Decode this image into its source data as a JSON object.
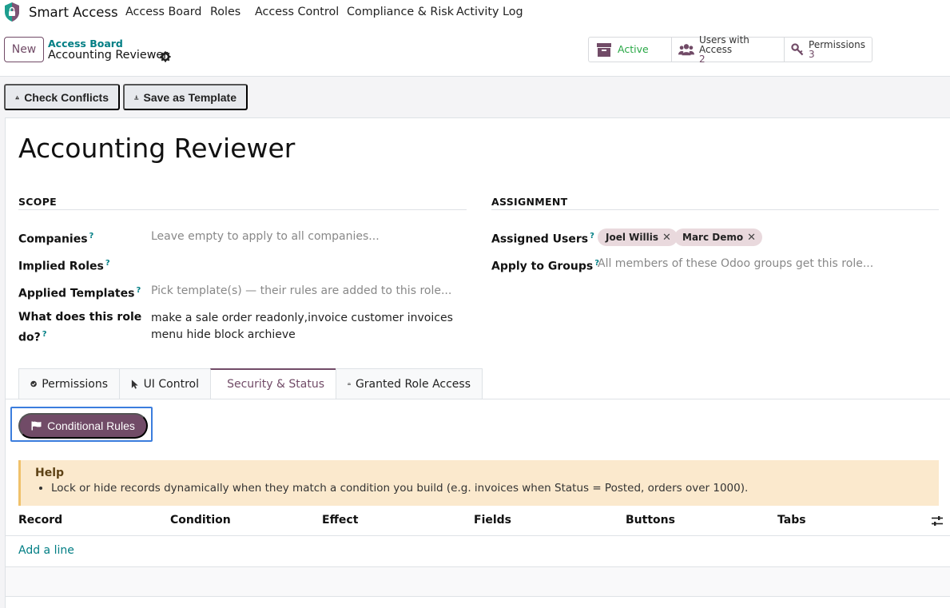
{
  "app": {
    "name": "Smart Access",
    "nav": [
      "Access Board",
      "Roles",
      "Access Control",
      "Compliance & Risk",
      "Activity Log"
    ]
  },
  "control_panel": {
    "new_label": "New",
    "breadcrumb_parent": "Access Board",
    "breadcrumb_current": "Accounting Reviewer",
    "smart_buttons": {
      "active": {
        "label": "Active"
      },
      "users": {
        "label": "Users with Access",
        "count": "2"
      },
      "permissions": {
        "label": "Permissions",
        "count": "3"
      }
    }
  },
  "status_bar": {
    "check_conflicts": "Check Conflicts",
    "save_template": "Save as Template"
  },
  "form": {
    "title": "Accounting Reviewer",
    "scope": {
      "heading": "SCOPE",
      "companies": {
        "label": "Companies",
        "help": "?",
        "placeholder": "Leave empty to apply to all companies..."
      },
      "implied_roles": {
        "label": "Implied Roles",
        "help": "?"
      },
      "applied_templates": {
        "label": "Applied Templates",
        "help": "?",
        "placeholder": "Pick template(s) — their rules are added to this role..."
      },
      "what_does": {
        "label_1": "What does this role",
        "label_2": "do?",
        "help": "?",
        "value": "make a sale order readonly,invoice customer invoices menu hide block archieve"
      }
    },
    "assignment": {
      "heading": "ASSIGNMENT",
      "assigned_users": {
        "label": "Assigned Users",
        "help": "?",
        "tags": [
          "Joel Willis",
          "Marc Demo"
        ]
      },
      "apply_groups": {
        "label": "Apply to Groups",
        "help": "?",
        "placeholder": "All members of these Odoo groups get this role..."
      }
    },
    "tabs": [
      "Permissions",
      "UI Control",
      "Security & Status",
      "Granted Role Access"
    ],
    "active_tab": "Security & Status",
    "conditional_rules_label": "Conditional Rules",
    "help": {
      "title": "Help",
      "item": "Lock or hide records dynamically when they match a condition you build (e.g. invoices when Status = Posted, orders over 1000)."
    },
    "table": {
      "columns": [
        "Record",
        "Condition",
        "Effect",
        "Fields",
        "Buttons",
        "Tabs"
      ],
      "add_line": "Add a line"
    }
  },
  "colors": {
    "brand": "#714b67",
    "link": "#017e84",
    "active_green": "#28a745",
    "focus": "#3b7ddd"
  }
}
